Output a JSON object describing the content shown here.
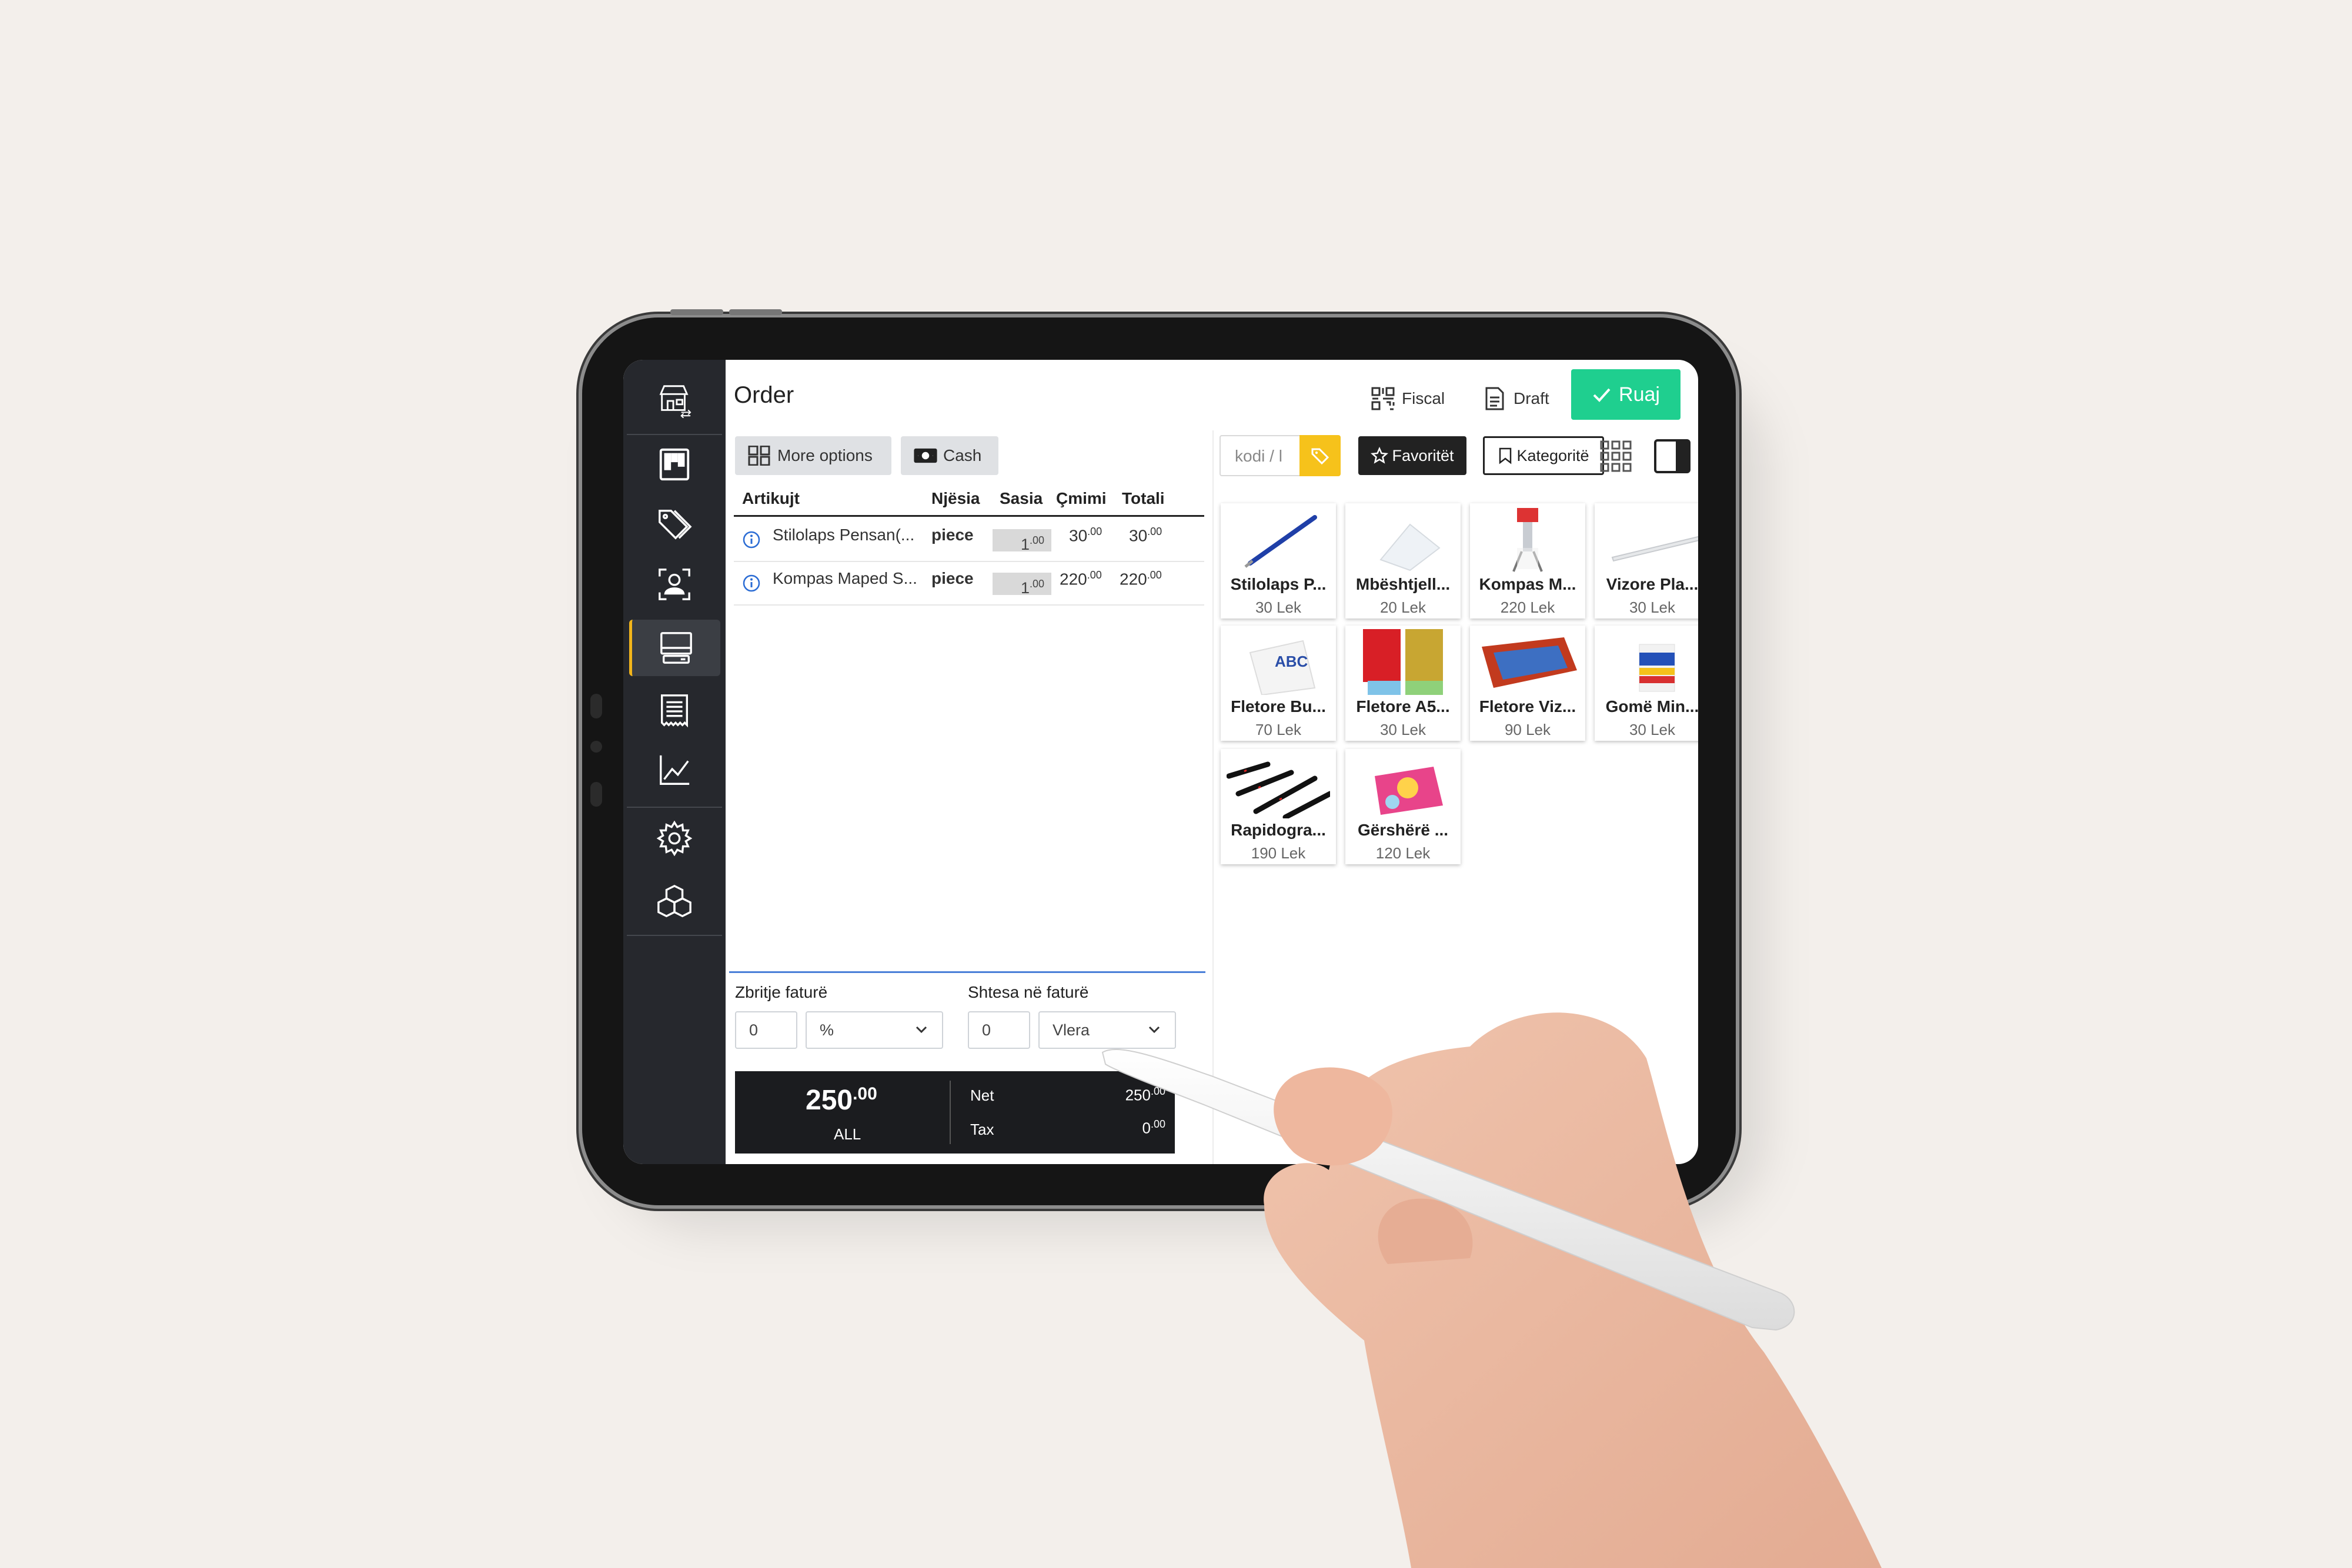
{
  "page": {
    "title": "Order"
  },
  "header": {
    "fiscal_label": "Fiscal",
    "draft_label": "Draft",
    "save_label": "Ruaj"
  },
  "sidebar": {
    "items": [
      {
        "icon": "store-switch-icon"
      },
      {
        "icon": "board-icon"
      },
      {
        "icon": "tags-icon"
      },
      {
        "icon": "user-scan-icon"
      },
      {
        "icon": "pos-terminal-icon",
        "active": true
      },
      {
        "icon": "receipt-icon"
      },
      {
        "icon": "chart-icon"
      },
      {
        "icon": "gear-icon"
      },
      {
        "icon": "boxes-icon"
      }
    ],
    "accent": "#f2b51b"
  },
  "order": {
    "more_options_label": "More options",
    "cash_label": "Cash",
    "columns": [
      "Artikujt",
      "Njësia",
      "Sasia",
      "Çmimi",
      "Totali"
    ],
    "rows": [
      {
        "item": "Stilolaps Pensan(...",
        "unit": "piece",
        "qty": "1",
        "qty_dec": ".00",
        "price": "30",
        "price_dec": ".00",
        "total": "30",
        "total_dec": ".00"
      },
      {
        "item": "Kompas Maped S...",
        "unit": "piece",
        "qty": "1",
        "qty_dec": ".00",
        "price": "220",
        "price_dec": ".00",
        "total": "220",
        "total_dec": ".00"
      }
    ],
    "discount_label": "Zbritje faturë",
    "discount_value": "0",
    "discount_type": "%",
    "surcharge_label": "Shtesa në faturë",
    "surcharge_value": "0",
    "surcharge_type": "Vlera",
    "total": "250",
    "total_dec": ".00",
    "currency": "ALL",
    "net_label": "Net",
    "net_value": "250",
    "net_dec": ".00",
    "tax_label": "Tax",
    "tax_value": "0",
    "tax_dec": ".00"
  },
  "products": {
    "search_placeholder": "kodi / l",
    "favorites_label": "Favoritët",
    "categories_label": "Kategoritë",
    "items": [
      {
        "name": "Stilolaps P...",
        "price": "30 Lek"
      },
      {
        "name": "Mbështjell...",
        "price": "20 Lek"
      },
      {
        "name": "Kompas M...",
        "price": "220 Lek"
      },
      {
        "name": "Vizore Pla...",
        "price": "30 Lek"
      },
      {
        "name": "Fletore Bu...",
        "price": "70 Lek"
      },
      {
        "name": "Fletore A5...",
        "price": "30 Lek"
      },
      {
        "name": "Fletore Viz...",
        "price": "90 Lek"
      },
      {
        "name": "Gomë Min...",
        "price": "30 Lek"
      },
      {
        "name": "Rapidogra...",
        "price": "190 Lek"
      },
      {
        "name": "Gërshërë ...",
        "price": "120 Lek"
      }
    ]
  },
  "colors": {
    "save_green": "#1fcf8f",
    "sidebar_bg": "#26282d",
    "tag_yellow": "#f6c21b",
    "divider_blue": "#4a7fd8"
  }
}
